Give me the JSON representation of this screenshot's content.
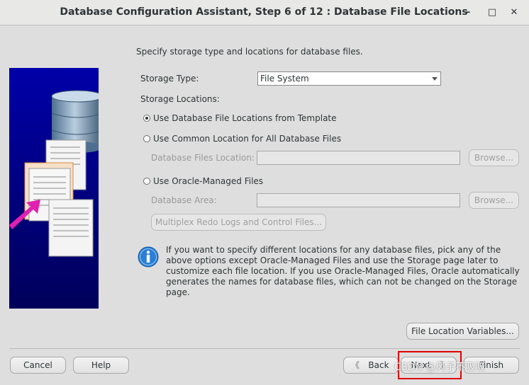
{
  "window": {
    "title": "Database Configuration Assistant, Step 6 of 12 : Database File Locations",
    "minimize_glyph": "–",
    "maximize_glyph": "□",
    "close_glyph": "✕"
  },
  "content": {
    "intro": "Specify storage type and locations for database files.",
    "storage_type_label": "Storage Type:",
    "storage_type_value": "File System",
    "storage_locations_label": "Storage Locations:",
    "option_template": "Use Database File Locations from Template",
    "option_common": "Use Common Location for All Database Files",
    "db_files_location_label": "Database Files Location:",
    "db_files_location_value": "",
    "browse_1": "Browse...",
    "option_omf": "Use Oracle-Managed Files",
    "db_area_label": "Database Area:",
    "db_area_value": "",
    "browse_2": "Browse...",
    "multiplex_button": "Multiplex Redo Logs and Control Files...",
    "info_text": "If you want to specify different locations for any database files, pick any of the above options except Oracle-Managed Files and use the Storage page later to customize each file location. If you use Oracle-Managed Files, Oracle automatically generates the names for database files, which can not be changed on the Storage page.",
    "file_location_variables": "File Location Variables..."
  },
  "footer": {
    "cancel": "Cancel",
    "help": "Help",
    "back": "Back",
    "next": "Next",
    "finish": "Finish",
    "watermark": "CSDN @风子不吸吸"
  },
  "state": {
    "selected_storage_option": "template"
  },
  "colors": {
    "background": "#dedede",
    "side_image_bg": "#000080",
    "highlight": "#e00000",
    "info_icon": "#2a7fd4"
  },
  "icons": [
    "minimize-icon",
    "maximize-icon",
    "close-icon",
    "info-icon",
    "back-arrow-icon",
    "next-arrow-icon"
  ]
}
